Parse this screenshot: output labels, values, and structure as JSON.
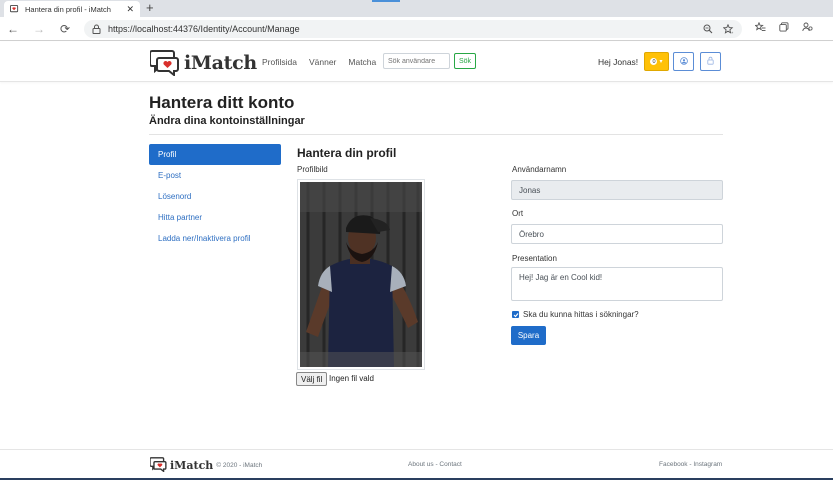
{
  "browser": {
    "tab_title": "Hantera din profil - iMatch",
    "tab_close": "✕",
    "new_tab": "+",
    "url": "https://localhost:44376/Identity/Account/Manage",
    "nav": {
      "back": "←",
      "forward": "→",
      "reload": "⟳"
    }
  },
  "navbar": {
    "brand": "iMatch",
    "links": [
      "Profilsida",
      "Vänner",
      "Matcha"
    ],
    "search_placeholder": "Sök användare",
    "search_button": "Sök",
    "greeting": "Hej Jonas!",
    "notification_count": "0",
    "notification_caret": "▾",
    "colors": {
      "warning": "#ffc107",
      "primary": "#1f6cc9",
      "success": "#28a745"
    }
  },
  "header": {
    "title": "Hantera ditt konto",
    "subtitle": "Ändra dina kontoinställningar"
  },
  "sidebar": {
    "items": [
      {
        "label": "Profil",
        "active": true
      },
      {
        "label": "E-post",
        "active": false
      },
      {
        "label": "Lösenord",
        "active": false
      },
      {
        "label": "Hitta partner",
        "active": false
      },
      {
        "label": "Ladda ner/Inaktivera profil",
        "active": false
      }
    ]
  },
  "profile": {
    "title": "Hantera din profil",
    "picture_label": "Profilbild",
    "file_button": "Välj fil",
    "file_status": "Ingen fil vald",
    "username_label": "Användarnamn",
    "username_value": "Jonas",
    "city_label": "Ort",
    "city_value": "Örebro",
    "presentation_label": "Presentation",
    "presentation_value": "Hej! Jag är en Cool kid!",
    "searchable_label": "Ska du kunna hittas i sökningar?",
    "searchable_checked": true,
    "save_button": "Spara"
  },
  "footer": {
    "brand": "iMatch",
    "copyright": "© 2020 - iMatch",
    "center": "About us - Contact",
    "right": "Facebook - Instagram"
  }
}
